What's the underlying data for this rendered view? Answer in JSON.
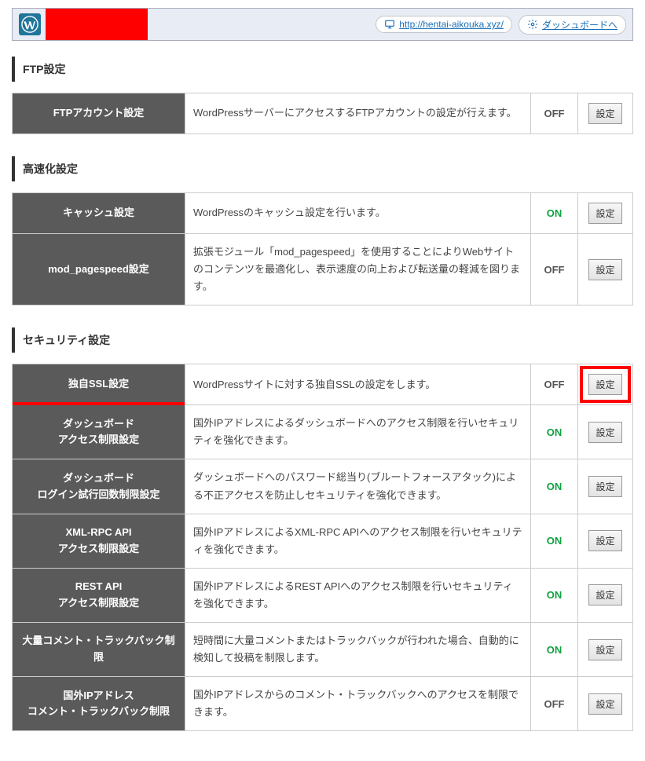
{
  "topbar": {
    "site_url": "http://hentai-aikouka.xyz/",
    "dashboard_label": "ダッシュボードへ"
  },
  "sections": {
    "ftp": {
      "title": "FTP設定",
      "rows": [
        {
          "label": "FTPアカウント設定",
          "desc": "WordPressサーバーにアクセスするFTPアカウントの設定が行えます。",
          "status": "OFF",
          "btn": "設定"
        }
      ]
    },
    "speed": {
      "title": "高速化設定",
      "rows": [
        {
          "label": "キャッシュ設定",
          "desc": "WordPressのキャッシュ設定を行います。",
          "status": "ON",
          "btn": "設定"
        },
        {
          "label": "mod_pagespeed設定",
          "desc": "拡張モジュール「mod_pagespeed」を使用することによりWebサイトのコンテンツを最適化し、表示速度の向上および転送量の軽減を図ります。",
          "status": "OFF",
          "btn": "設定"
        }
      ]
    },
    "security": {
      "title": "セキュリティ設定",
      "rows": [
        {
          "label": "独自SSL設定",
          "desc": "WordPressサイトに対する独自SSLの設定をします。",
          "status": "OFF",
          "btn": "設定",
          "highlight": true
        },
        {
          "label": "ダッシュボード\nアクセス制限設定",
          "desc": "国外IPアドレスによるダッシュボードへのアクセス制限を行いセキュリティを強化できます。",
          "status": "ON",
          "btn": "設定"
        },
        {
          "label": "ダッシュボード\nログイン試行回数制限設定",
          "desc": "ダッシュボードへのパスワード総当り(ブルートフォースアタック)による不正アクセスを防止しセキュリティを強化できます。",
          "status": "ON",
          "btn": "設定"
        },
        {
          "label": "XML-RPC API\nアクセス制限設定",
          "desc": "国外IPアドレスによるXML-RPC APIへのアクセス制限を行いセキュリティを強化できます。",
          "status": "ON",
          "btn": "設定"
        },
        {
          "label": "REST API\nアクセス制限設定",
          "desc": "国外IPアドレスによるREST APIへのアクセス制限を行いセキュリティを強化できます。",
          "status": "ON",
          "btn": "設定"
        },
        {
          "label": "大量コメント・トラックバック制限",
          "desc": "短時間に大量コメントまたはトラックバックが行われた場合、自動的に検知して投稿を制限します。",
          "status": "ON",
          "btn": "設定"
        },
        {
          "label": "国外IPアドレス\nコメント・トラックバック制限",
          "desc": "国外IPアドレスからのコメント・トラックバックへのアクセスを制限できます。",
          "status": "OFF",
          "btn": "設定"
        }
      ]
    }
  }
}
